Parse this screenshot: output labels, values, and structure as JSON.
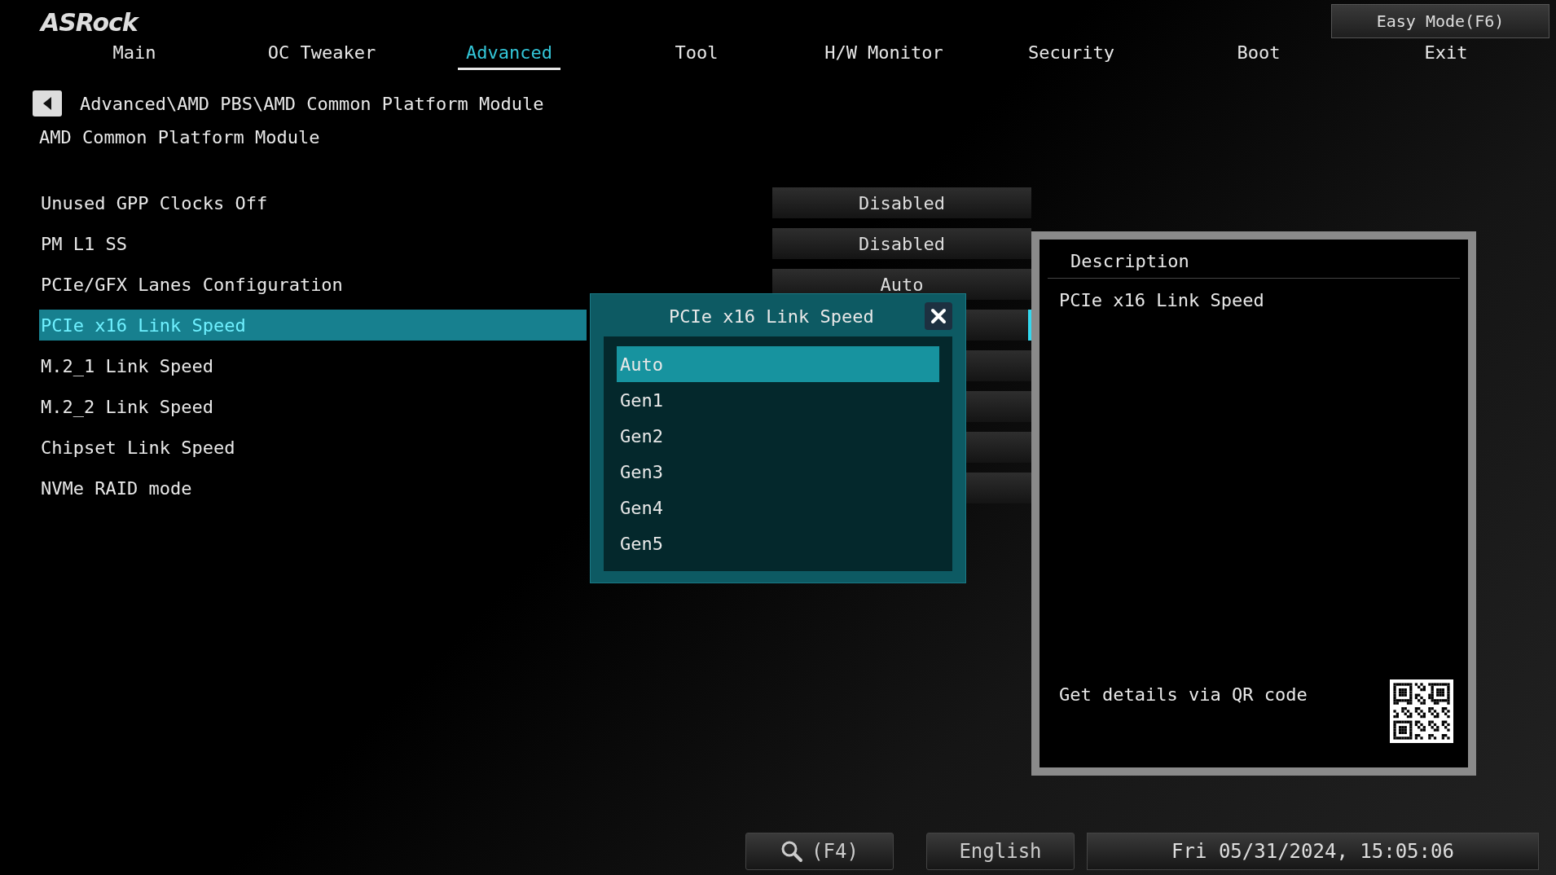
{
  "brand": "ASRock",
  "easy_mode_button": "Easy Mode(F6)",
  "tabs": [
    {
      "label": "Main",
      "selected": false
    },
    {
      "label": "OC Tweaker",
      "selected": false
    },
    {
      "label": "Advanced",
      "selected": true
    },
    {
      "label": "Tool",
      "selected": false
    },
    {
      "label": "H/W Monitor",
      "selected": false
    },
    {
      "label": "Security",
      "selected": false
    },
    {
      "label": "Boot",
      "selected": false
    },
    {
      "label": "Exit",
      "selected": false
    }
  ],
  "breadcrumb": "Advanced\\AMD PBS\\AMD Common Platform Module",
  "page_title": "AMD Common Platform Module",
  "settings": [
    {
      "label": "Unused GPP Clocks Off",
      "value": "Disabled",
      "selected": false
    },
    {
      "label": "PM L1 SS",
      "value": "Disabled",
      "selected": false
    },
    {
      "label": "PCIe/GFX Lanes Configuration",
      "value": "Auto",
      "selected": false
    },
    {
      "label": "PCIe x16 Link Speed",
      "selected": true
    },
    {
      "label": "M.2_1 Link Speed",
      "selected": false
    },
    {
      "label": "M.2_2 Link Speed",
      "selected": false
    },
    {
      "label": "Chipset Link Speed",
      "selected": false
    },
    {
      "label": "NVMe RAID mode",
      "selected": false
    }
  ],
  "popup": {
    "title": "PCIe x16 Link Speed",
    "options": [
      {
        "label": "Auto",
        "selected": true
      },
      {
        "label": "Gen1",
        "selected": false
      },
      {
        "label": "Gen2",
        "selected": false
      },
      {
        "label": "Gen3",
        "selected": false
      },
      {
        "label": "Gen4",
        "selected": false
      },
      {
        "label": "Gen5",
        "selected": false
      }
    ]
  },
  "description": {
    "heading": "Description",
    "text": "PCIe x16 Link Speed",
    "qr_label": "Get details via QR code"
  },
  "status_bar": {
    "search": "(F4)",
    "language": "English",
    "datetime": "Fri 05/31/2024, 15:05:06"
  }
}
